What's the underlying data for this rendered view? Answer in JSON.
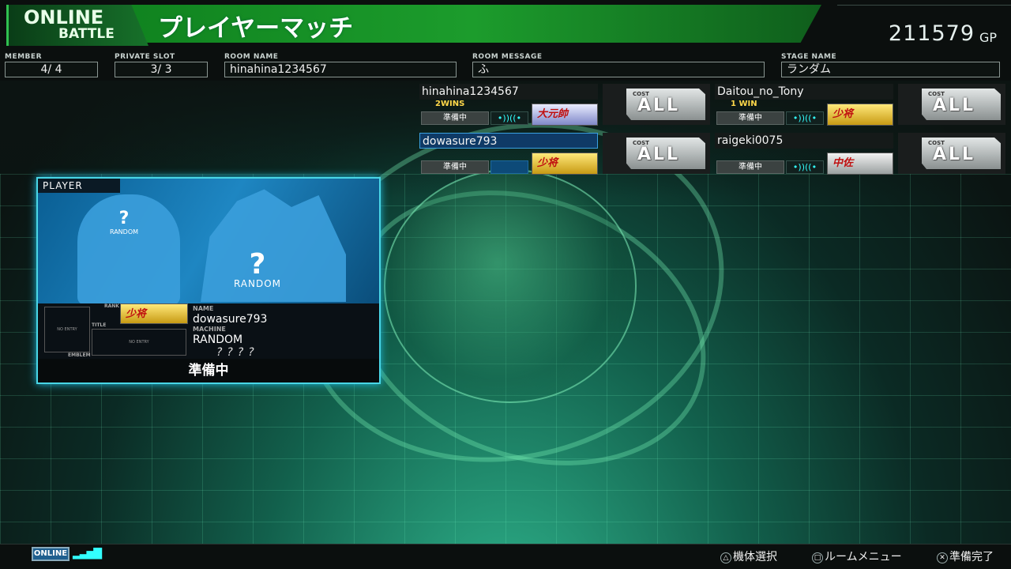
{
  "header": {
    "logo_line1": "ONLINE",
    "logo_line2": "BATTLE",
    "title": "プレイヤーマッチ",
    "gp_value": "211579",
    "gp_unit": "GP"
  },
  "room_info": {
    "member_label": "MEMBER",
    "member_value": "4/ 4",
    "private_label": "PRIVATE SLOT",
    "private_value": "3/ 3",
    "room_name_label": "ROOM NAME",
    "room_name_value": "hinahina1234567",
    "room_message_label": "ROOM MESSAGE",
    "room_message_value": "ふ",
    "stage_label": "STAGE NAME",
    "stage_value": "ランダム"
  },
  "slots": [
    {
      "name": "hinahina1234567",
      "wins": "2WINS",
      "status": "準備中",
      "signal": "•))((•",
      "rank": "大元帥",
      "cost_label": "COST",
      "cost": "ALL"
    },
    {
      "name": "Daitou_no_Tony",
      "wins": "1 WIN",
      "status": "準備中",
      "signal": "•))((•",
      "rank": "少将",
      "cost_label": "COST",
      "cost": "ALL"
    },
    {
      "name": "dowasure793",
      "wins": "",
      "status": "準備中",
      "signal": "",
      "rank": "少将",
      "cost_label": "COST",
      "cost": "ALL"
    },
    {
      "name": "raigeki0075",
      "wins": "",
      "status": "準備中",
      "signal": "•))((•",
      "rank": "中佐",
      "cost_label": "COST",
      "cost": "ALL"
    }
  ],
  "player_card": {
    "label": "PLAYER",
    "pilot_q": "?",
    "pilot_random": "RANDOM",
    "machine_q": "?",
    "machine_random": "RANDOM",
    "rank_label": "RANK",
    "rank": "少将",
    "title_label": "TITLE",
    "emblem_label": "EMBLEM",
    "no_entry": "NO ENTRY",
    "name_label": "NAME",
    "name": "dowasure793",
    "machine_label": "MACHINE",
    "machine": "RANDOM",
    "machine_unknown": "????",
    "status": "準備中"
  },
  "footer": {
    "online": "ONLINE",
    "triangle_label": "機体選択",
    "square_label": "ルームメニュー",
    "cross_label": "準備完了"
  }
}
